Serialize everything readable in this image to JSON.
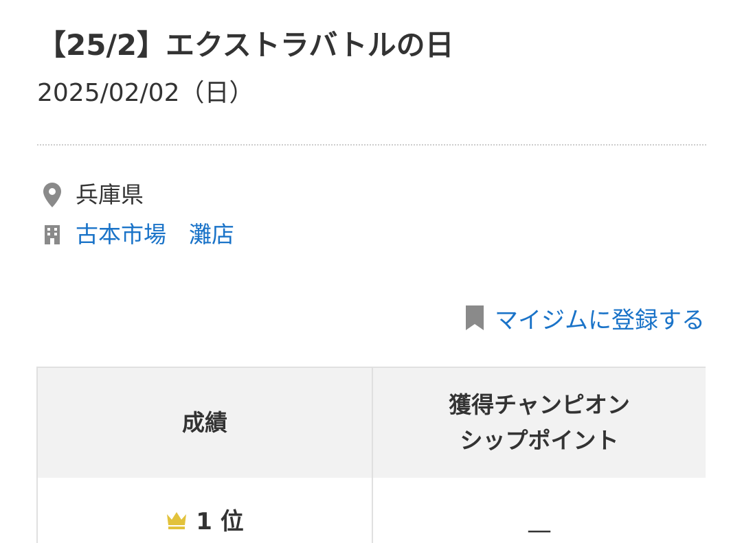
{
  "event": {
    "title": "【25/2】エクストラバトルの日",
    "date": "2025/02/02（日）"
  },
  "location": {
    "prefecture": "兵庫県",
    "shop_name": "古本市場　灘店",
    "prefecture_icon": "location-pin-icon",
    "shop_icon": "building-icon"
  },
  "mygym": {
    "label": "マイジムに登録する",
    "icon": "bookmark-icon"
  },
  "results_table": {
    "headers": {
      "result": "成績",
      "points_line1": "獲得チャンピオン",
      "points_line2": "シップポイント"
    },
    "rows": [
      {
        "rank": "1 位",
        "points": "—"
      }
    ]
  },
  "colors": {
    "link": "#1a73c8",
    "text": "#333333",
    "icon_gray": "#8a8a8a",
    "crown_gold": "#e2c23c",
    "header_bg": "#f2f2f2",
    "border": "#e0e0e0"
  }
}
